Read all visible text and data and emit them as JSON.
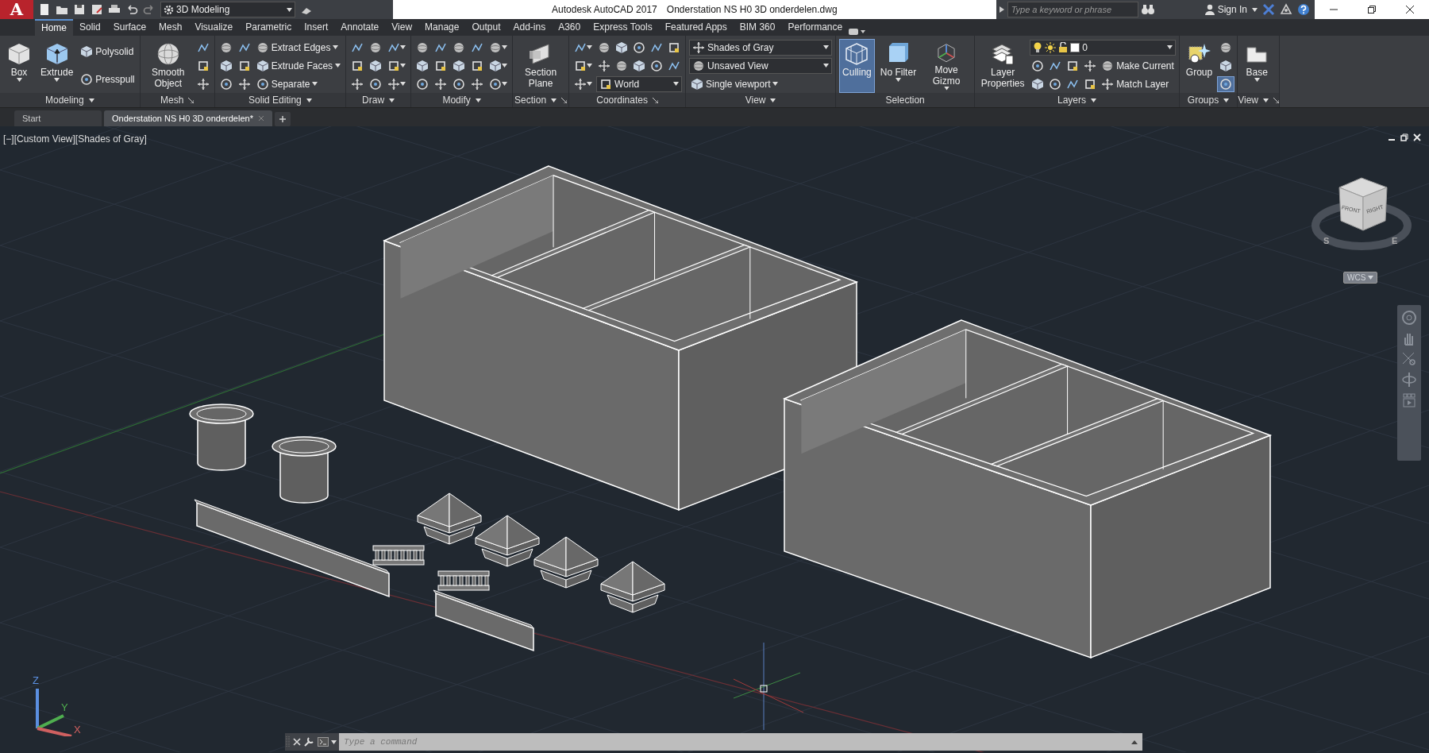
{
  "quick_access": {
    "logo": "A",
    "workspace": "3D Modeling"
  },
  "title": {
    "app": "Autodesk AutoCAD 2017",
    "file": "Onderstation NS H0 3D onderdelen.dwg"
  },
  "search": {
    "placeholder": "Type a keyword or phrase"
  },
  "account": {
    "label": "Sign In"
  },
  "ribbon_tabs": [
    {
      "label": "Home",
      "selected": true
    },
    {
      "label": "Solid",
      "selected": false
    },
    {
      "label": "Surface",
      "selected": false
    },
    {
      "label": "Mesh",
      "selected": false
    },
    {
      "label": "Visualize",
      "selected": false
    },
    {
      "label": "Parametric",
      "selected": false
    },
    {
      "label": "Insert",
      "selected": false
    },
    {
      "label": "Annotate",
      "selected": false
    },
    {
      "label": "View",
      "selected": false
    },
    {
      "label": "Manage",
      "selected": false
    },
    {
      "label": "Output",
      "selected": false
    },
    {
      "label": "Add-ins",
      "selected": false
    },
    {
      "label": "A360",
      "selected": false
    },
    {
      "label": "Express Tools",
      "selected": false
    },
    {
      "label": "Featured Apps",
      "selected": false
    },
    {
      "label": "BIM 360",
      "selected": false
    },
    {
      "label": "Performance",
      "selected": false
    }
  ],
  "ribbon_panels": [
    {
      "title": "Modeling",
      "menu": true,
      "launcher": false,
      "columns": [
        [
          [
            {
              "kind": "large",
              "label": "Box",
              "menu": true
            }
          ]
        ],
        [
          [
            {
              "kind": "large",
              "label": "Extrude",
              "menu": true
            }
          ]
        ],
        [
          [
            {
              "kind": "small",
              "label": "Polysolid",
              "menu": false
            }
          ],
          [
            {
              "kind": "small",
              "label": "Presspull",
              "menu": false
            }
          ]
        ]
      ]
    },
    {
      "title": "Mesh",
      "menu": false,
      "launcher": true,
      "columns": [
        [
          [
            {
              "kind": "large",
              "label": "Smooth Object",
              "menu": false
            }
          ]
        ],
        [
          [
            {
              "kind": "icon",
              "menu": false
            }
          ],
          [
            {
              "kind": "icon",
              "menu": false
            }
          ],
          [
            {
              "kind": "icon",
              "menu": false
            }
          ]
        ]
      ]
    },
    {
      "title": "Solid Editing",
      "menu": true,
      "launcher": false,
      "columns": [
        [
          [
            {
              "kind": "icon",
              "menu": false
            }
          ],
          [
            {
              "kind": "icon",
              "menu": false
            }
          ],
          [
            {
              "kind": "icon",
              "menu": false
            }
          ]
        ],
        [
          [
            {
              "kind": "icon",
              "menu": false
            }
          ],
          [
            {
              "kind": "icon",
              "menu": false
            }
          ],
          [
            {
              "kind": "icon",
              "menu": false
            }
          ]
        ],
        [
          [
            {
              "kind": "small",
              "label": "Extract Edges",
              "menu": true
            }
          ],
          [
            {
              "kind": "small",
              "label": "Extrude Faces",
              "menu": true
            }
          ],
          [
            {
              "kind": "small",
              "label": "Separate",
              "menu": true
            }
          ]
        ]
      ]
    },
    {
      "title": "Draw",
      "menu": true,
      "launcher": false,
      "columns": [
        [
          [
            {
              "kind": "icon",
              "menu": false
            }
          ],
          [
            {
              "kind": "icon",
              "menu": false
            }
          ],
          [
            {
              "kind": "icon",
              "menu": false
            }
          ]
        ],
        [
          [
            {
              "kind": "icon",
              "menu": false
            }
          ],
          [
            {
              "kind": "icon",
              "menu": false
            }
          ],
          [
            {
              "kind": "icon",
              "menu": false
            }
          ]
        ],
        [
          [
            {
              "kind": "icon",
              "menu": true
            }
          ],
          [
            {
              "kind": "icon",
              "menu": true
            }
          ],
          [
            {
              "kind": "icon",
              "menu": true
            }
          ]
        ]
      ]
    },
    {
      "title": "Modify",
      "menu": true,
      "launcher": false,
      "columns": [
        [
          [
            {
              "kind": "icon",
              "menu": false
            }
          ],
          [
            {
              "kind": "icon",
              "menu": false
            }
          ],
          [
            {
              "kind": "icon",
              "menu": false
            }
          ]
        ],
        [
          [
            {
              "kind": "icon",
              "menu": false
            }
          ],
          [
            {
              "kind": "icon",
              "menu": false
            }
          ],
          [
            {
              "kind": "icon",
              "menu": false
            }
          ]
        ],
        [
          [
            {
              "kind": "icon",
              "menu": false
            }
          ],
          [
            {
              "kind": "icon",
              "menu": false
            }
          ],
          [
            {
              "kind": "icon",
              "menu": false
            }
          ]
        ],
        [
          [
            {
              "kind": "icon",
              "menu": false
            }
          ],
          [
            {
              "kind": "icon",
              "menu": false
            }
          ],
          [
            {
              "kind": "icon",
              "menu": false
            }
          ]
        ],
        [
          [
            {
              "kind": "icon",
              "menu": true
            }
          ],
          [
            {
              "kind": "icon",
              "menu": true
            }
          ],
          [
            {
              "kind": "icon",
              "menu": true
            }
          ]
        ]
      ]
    },
    {
      "title": "Section",
      "menu": true,
      "launcher": true,
      "columns": [
        [
          [
            {
              "kind": "large",
              "label": "Section Plane",
              "menu": false
            }
          ]
        ]
      ]
    },
    {
      "title": "Coordinates",
      "menu": false,
      "launcher": true,
      "columns": [
        [
          [
            {
              "kind": "icon",
              "menu": true
            }
          ],
          [
            {
              "kind": "icon",
              "menu": true
            }
          ],
          [
            {
              "kind": "icon",
              "menu": true
            }
          ]
        ],
        [
          [
            {
              "kind": "icon",
              "menu": false
            },
            {
              "kind": "icon",
              "menu": false
            },
            {
              "kind": "icon",
              "menu": false
            },
            {
              "kind": "icon",
              "menu": false
            },
            {
              "kind": "icon",
              "menu": false
            }
          ],
          [
            {
              "kind": "icon",
              "menu": false
            },
            {
              "kind": "icon",
              "menu": false
            },
            {
              "kind": "icon",
              "menu": false
            },
            {
              "kind": "icon",
              "menu": false
            },
            {
              "kind": "icon",
              "menu": false
            }
          ],
          [
            {
              "kind": "dropdown",
              "value": "World"
            }
          ]
        ]
      ]
    },
    {
      "title": "View",
      "menu": true,
      "launcher": false,
      "columns": [
        [
          [
            {
              "kind": "dropdown",
              "value": "Shades of Gray"
            }
          ],
          [
            {
              "kind": "dropdown",
              "value": "Unsaved View"
            }
          ],
          [
            {
              "kind": "small",
              "label": "Single viewport",
              "menu": true
            }
          ]
        ]
      ]
    },
    {
      "title": "Selection",
      "menu": false,
      "launcher": false,
      "columns": [
        [
          [
            {
              "kind": "large",
              "label": "Culling",
              "menu": false,
              "on": true
            }
          ]
        ],
        [
          [
            {
              "kind": "large",
              "label": "No Filter",
              "menu": true,
              "on": false
            }
          ]
        ],
        [
          [
            {
              "kind": "large",
              "label": "Move Gizmo",
              "menu": true,
              "on": false
            }
          ]
        ]
      ]
    },
    {
      "title": "Layers",
      "menu": true,
      "launcher": false,
      "columns": [
        [
          [
            {
              "kind": "large",
              "label": "Layer Properties",
              "menu": false
            }
          ]
        ],
        [
          [
            {
              "kind": "layer_dropdown",
              "value": "0"
            }
          ],
          [
            {
              "kind": "icon",
              "menu": false
            },
            {
              "kind": "icon",
              "menu": false
            },
            {
              "kind": "icon",
              "menu": false
            },
            {
              "kind": "icon",
              "menu": false
            },
            {
              "kind": "small",
              "label": "Make Current",
              "menu": false
            }
          ],
          [
            {
              "kind": "icon",
              "menu": false
            },
            {
              "kind": "icon",
              "menu": false
            },
            {
              "kind": "icon",
              "menu": false
            },
            {
              "kind": "icon",
              "menu": false
            },
            {
              "kind": "small",
              "label": "Match Layer",
              "menu": false
            }
          ]
        ]
      ]
    },
    {
      "title": "Groups",
      "menu": true,
      "launcher": false,
      "columns": [
        [
          [
            {
              "kind": "large",
              "label": "Group",
              "menu": false
            }
          ]
        ],
        [
          [
            {
              "kind": "icon",
              "menu": false,
              "on": false
            }
          ],
          [
            {
              "kind": "icon",
              "menu": false,
              "on": false
            }
          ],
          [
            {
              "kind": "icon",
              "menu": false,
              "on": true
            }
          ]
        ]
      ]
    },
    {
      "title": "View",
      "menu": true,
      "launcher": true,
      "columns": [
        [
          [
            {
              "kind": "large",
              "label": "Base",
              "menu": true
            }
          ]
        ]
      ]
    }
  ],
  "file_tabs": [
    {
      "label": "Start",
      "selected": false
    },
    {
      "label": "Onderstation NS H0 3D onderdelen*",
      "selected": true
    }
  ],
  "viewport": {
    "label": "[−][Custom View][Shades of Gray]",
    "viewcube_faces": [
      "FRONT",
      "RIGHT"
    ],
    "compass": [
      "S",
      "E"
    ],
    "ucs_menu": "WCS",
    "axes": [
      "Z",
      "Y",
      "X"
    ]
  },
  "command_line": {
    "placeholder": "Type a command"
  }
}
